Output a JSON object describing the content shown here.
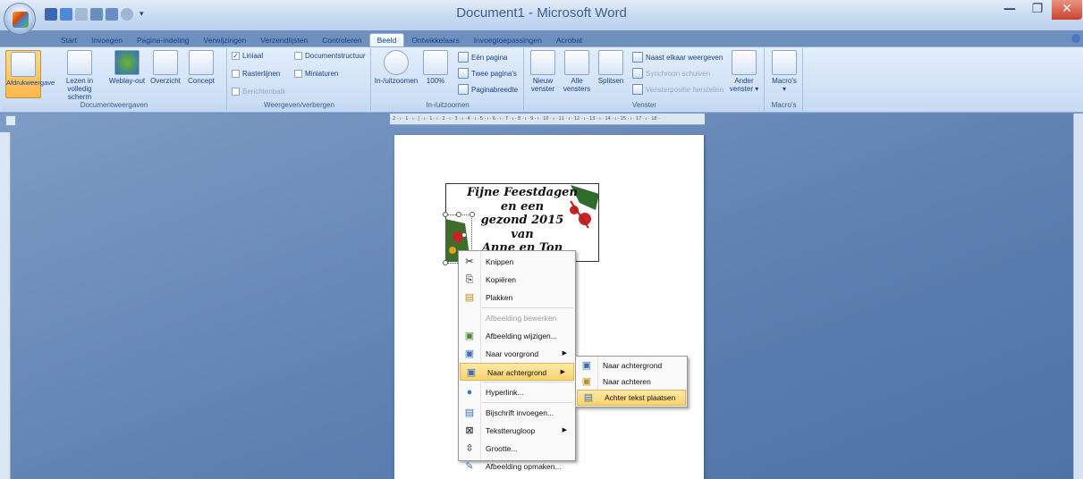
{
  "window": {
    "title": "Document1 - Microsoft Word",
    "minimize": "—",
    "maximize": "❐",
    "close": "✕"
  },
  "tabs": [
    "Start",
    "Invoegen",
    "Pagina-indeling",
    "Verwijzingen",
    "Verzendlijsten",
    "Controleren",
    "Beeld",
    "Ontwikkelaars",
    "Invoegtoepassingen",
    "Acrobat"
  ],
  "active_tab": "Beeld",
  "ribbon": {
    "documentweergaven": {
      "label": "Documentweergaven",
      "buttons": [
        "Afdrukweergave",
        "Lezen in volledig scherm",
        "Weblay-out",
        "Overzicht",
        "Concept"
      ]
    },
    "weergeven": {
      "label": "Weergeven/verbergen",
      "liniaal": "Liniaal",
      "rasterlijnen": "Rasterlijnen",
      "berichtenbalk": "Berichtenbalk",
      "documentstructuur": "Documentstructuur",
      "miniaturen": "Miniaturen"
    },
    "zoom": {
      "label": "In-/uitzoomen",
      "zoom_btn": "In-/uitzoomen",
      "pct": "100%",
      "een_pagina": "Eén pagina",
      "twee_paginas": "Twee pagina's",
      "paginabreedte": "Paginabreedte"
    },
    "venster": {
      "label": "Venster",
      "nieuw": "Nieuw venster",
      "alle": "Alle vensters",
      "splitsen": "Splitsen",
      "naast_elkaar": "Naast elkaar weergeven",
      "synchroon": "Synchroon schuiven",
      "vensterpositie": "Vensterpositie herstellen",
      "ander": "Ander venster"
    },
    "macros": {
      "label": "Macro's",
      "button": "Macro's"
    }
  },
  "ruler_text": "· 2 · ı · 1 · ı · [ · ı · 1 · ı · 2 · ı · 3 · ı · 4 · ı · 5 · ı · 6 · ı · 7 · ı · 8 · ı · 9 · ı · 10 · ı · 11 · ı · 12 · ı · 13 · ı · 14 · ı · 15 · ı · 17 · ı · 18 ·",
  "card": {
    "lines": [
      "Fijne Feestdagen",
      "en een",
      "gezond 2015",
      "van",
      "Anne en Ton"
    ]
  },
  "context_menu": [
    {
      "label": "Knippen",
      "icon": "scissors-icon",
      "glyph": "✂"
    },
    {
      "label": "Kopiëren",
      "icon": "copy-icon",
      "glyph": "⎘"
    },
    {
      "label": "Plakken",
      "icon": "paste-icon",
      "glyph": "📋"
    },
    {
      "label": "Afbeelding bewerken",
      "icon": "",
      "glyph": "",
      "disabled": true
    },
    {
      "label": "Afbeelding wijzigen...",
      "icon": "change-picture-icon",
      "glyph": "🖼"
    },
    {
      "label": "Naar voorgrond",
      "icon": "bring-forward-icon",
      "glyph": "▣",
      "submenu": true
    },
    {
      "label": "Naar achtergrond",
      "icon": "send-backward-icon",
      "glyph": "▣",
      "submenu": true,
      "highlight": true
    },
    {
      "label": "Hyperlink...",
      "icon": "hyperlink-icon",
      "glyph": "🌐"
    },
    {
      "label": "Bijschrift invoegen...",
      "icon": "caption-icon",
      "glyph": "▤"
    },
    {
      "label": "Tekstterugloop",
      "icon": "text-wrap-icon",
      "glyph": "⊠",
      "submenu": true
    },
    {
      "label": "Grootte...",
      "icon": "size-icon",
      "glyph": "⇳"
    },
    {
      "label": "Afbeelding opmaken...",
      "icon": "format-picture-icon",
      "glyph": "✎"
    }
  ],
  "submenu": [
    {
      "label": "Naar achtergrond",
      "icon": "send-backward-icon",
      "glyph": "▣"
    },
    {
      "label": "Naar achteren",
      "icon": "send-to-back-icon",
      "glyph": "▣"
    },
    {
      "label": "Achter tekst plaatsen",
      "icon": "behind-text-icon",
      "glyph": "▤",
      "highlight": true
    }
  ],
  "colors": {
    "accent": "#15428b",
    "highlight": "#fbd36b",
    "workspace": "#6f90bd"
  }
}
